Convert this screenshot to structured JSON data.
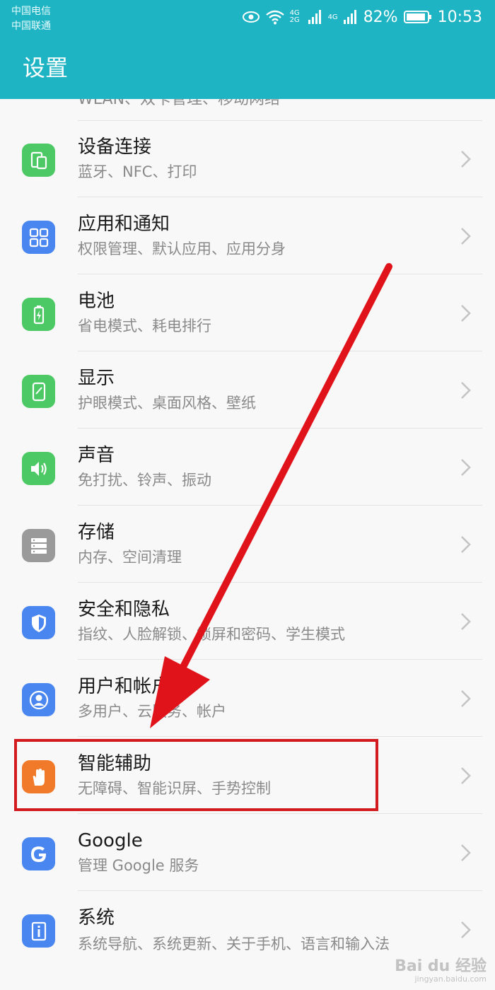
{
  "status_bar": {
    "carrier1": "中国电信",
    "carrier2": "中国联通",
    "network1": "4G 2G",
    "network2": "4G",
    "battery": "82%",
    "time": "10:53",
    "icons": [
      "eye-comfort-icon",
      "wifi-icon",
      "signal-icon",
      "battery-icon"
    ]
  },
  "header": {
    "title": "设置"
  },
  "cut_item": {
    "subtitle": "WLAN、双卡管理、移动网络"
  },
  "settings": [
    {
      "title": "设备连接",
      "subtitle": "蓝牙、NFC、打印",
      "icon": "device-connection-icon",
      "color": "#4cc964"
    },
    {
      "title": "应用和通知",
      "subtitle": "权限管理、默认应用、应用分身",
      "icon": "apps-grid-icon",
      "color": "#4a86f0"
    },
    {
      "title": "电池",
      "subtitle": "省电模式、耗电排行",
      "icon": "battery-icon",
      "color": "#4cc964"
    },
    {
      "title": "显示",
      "subtitle": "护眼模式、桌面风格、壁纸",
      "icon": "display-icon",
      "color": "#4cc964"
    },
    {
      "title": "声音",
      "subtitle": "免打扰、铃声、振动",
      "icon": "speaker-icon",
      "color": "#4cc964"
    },
    {
      "title": "存储",
      "subtitle": "内存、空间清理",
      "icon": "storage-icon",
      "color": "#9a9a9a"
    },
    {
      "title": "安全和隐私",
      "subtitle": "指纹、人脸解锁、锁屏和密码、学生模式",
      "icon": "shield-icon",
      "color": "#4a86f0"
    },
    {
      "title": "用户和帐户",
      "subtitle": "多用户、云服务、帐户",
      "icon": "user-icon",
      "color": "#4a86f0"
    },
    {
      "title": "智能辅助",
      "subtitle": "无障碍、智能识屏、手势控制",
      "icon": "hand-icon",
      "color": "#f07a2a"
    },
    {
      "title": "Google",
      "subtitle": "管理 Google 服务",
      "icon": "google-icon",
      "color": "#4a86f0"
    },
    {
      "title": "系统",
      "subtitle": "系统导航、系统更新、关于手机、语言和输入法",
      "icon": "system-info-icon",
      "color": "#4a86f0"
    }
  ],
  "annotation": {
    "arrow_color": "#e0131a",
    "box_color": "#d21a1f"
  },
  "watermark": {
    "main": "Bai du 经验",
    "sub": "jingyan.baidu.com"
  }
}
